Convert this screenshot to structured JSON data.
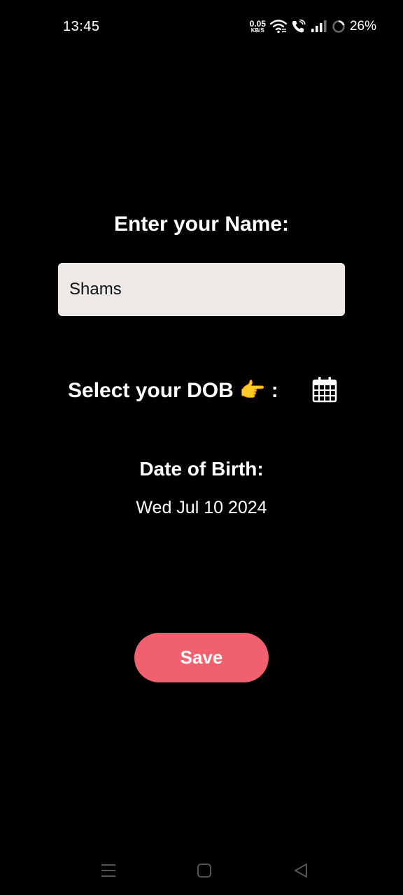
{
  "status_bar": {
    "time": "13:45",
    "net_speed_value": "0.05",
    "net_speed_unit": "KB/S",
    "battery": "26%",
    "icons": [
      "wifi-icon",
      "wifi-call-icon",
      "signal-icon",
      "battery-ring-icon"
    ]
  },
  "form": {
    "name_heading": "Enter your Name:",
    "name_value": "Shams",
    "dob_label": "Select your DOB 👉 :",
    "calendar_icon": "calendar-icon",
    "dob_title": "Date of Birth:",
    "dob_value": "Wed Jul 10 2024",
    "save_label": "Save"
  },
  "nav_bar": {
    "icons": [
      "menu-icon",
      "home-icon",
      "back-icon"
    ]
  },
  "colors": {
    "background": "#000000",
    "input_bg": "#ece9e7",
    "save_button": "#f0606e",
    "text": "#ffffff"
  }
}
